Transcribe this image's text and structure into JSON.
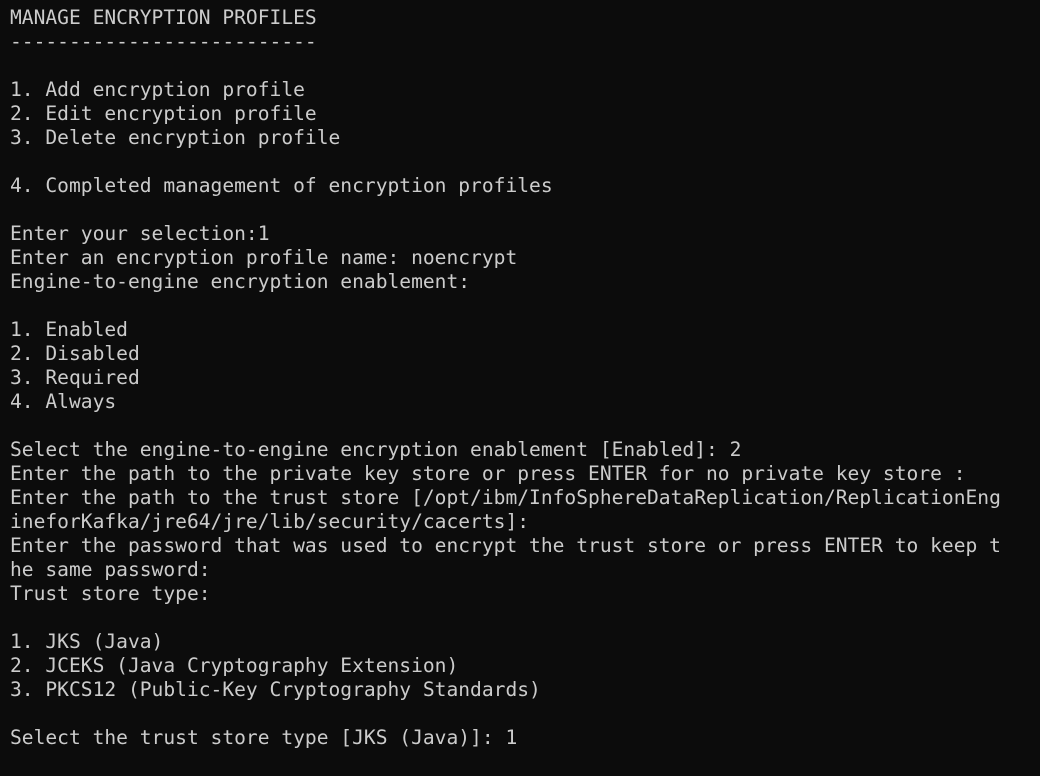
{
  "terminal": {
    "lines": [
      "MANAGE ENCRYPTION PROFILES",
      "--------------------------",
      "",
      "1. Add encryption profile",
      "2. Edit encryption profile",
      "3. Delete encryption profile",
      "",
      "4. Completed management of encryption profiles",
      "",
      "Enter your selection:1",
      "Enter an encryption profile name: noencrypt",
      "Engine-to-engine encryption enablement:",
      "",
      "1. Enabled",
      "2. Disabled",
      "3. Required",
      "4. Always",
      "",
      "Select the engine-to-engine encryption enablement [Enabled]: 2",
      "Enter the path to the private key store or press ENTER for no private key store :",
      "Enter the path to the trust store [/opt/ibm/InfoSphereDataReplication/ReplicationEng",
      "ineforKafka/jre64/jre/lib/security/cacerts]:",
      "Enter the password that was used to encrypt the trust store or press ENTER to keep t",
      "he same password:",
      "Trust store type:",
      "",
      "1. JKS (Java)",
      "2. JCEKS (Java Cryptography Extension)",
      "3. PKCS12 (Public-Key Cryptography Standards)",
      "",
      "Select the trust store type [JKS (Java)]: 1"
    ]
  },
  "colors": {
    "background": "#0c0c0c",
    "foreground": "#cccccc"
  }
}
